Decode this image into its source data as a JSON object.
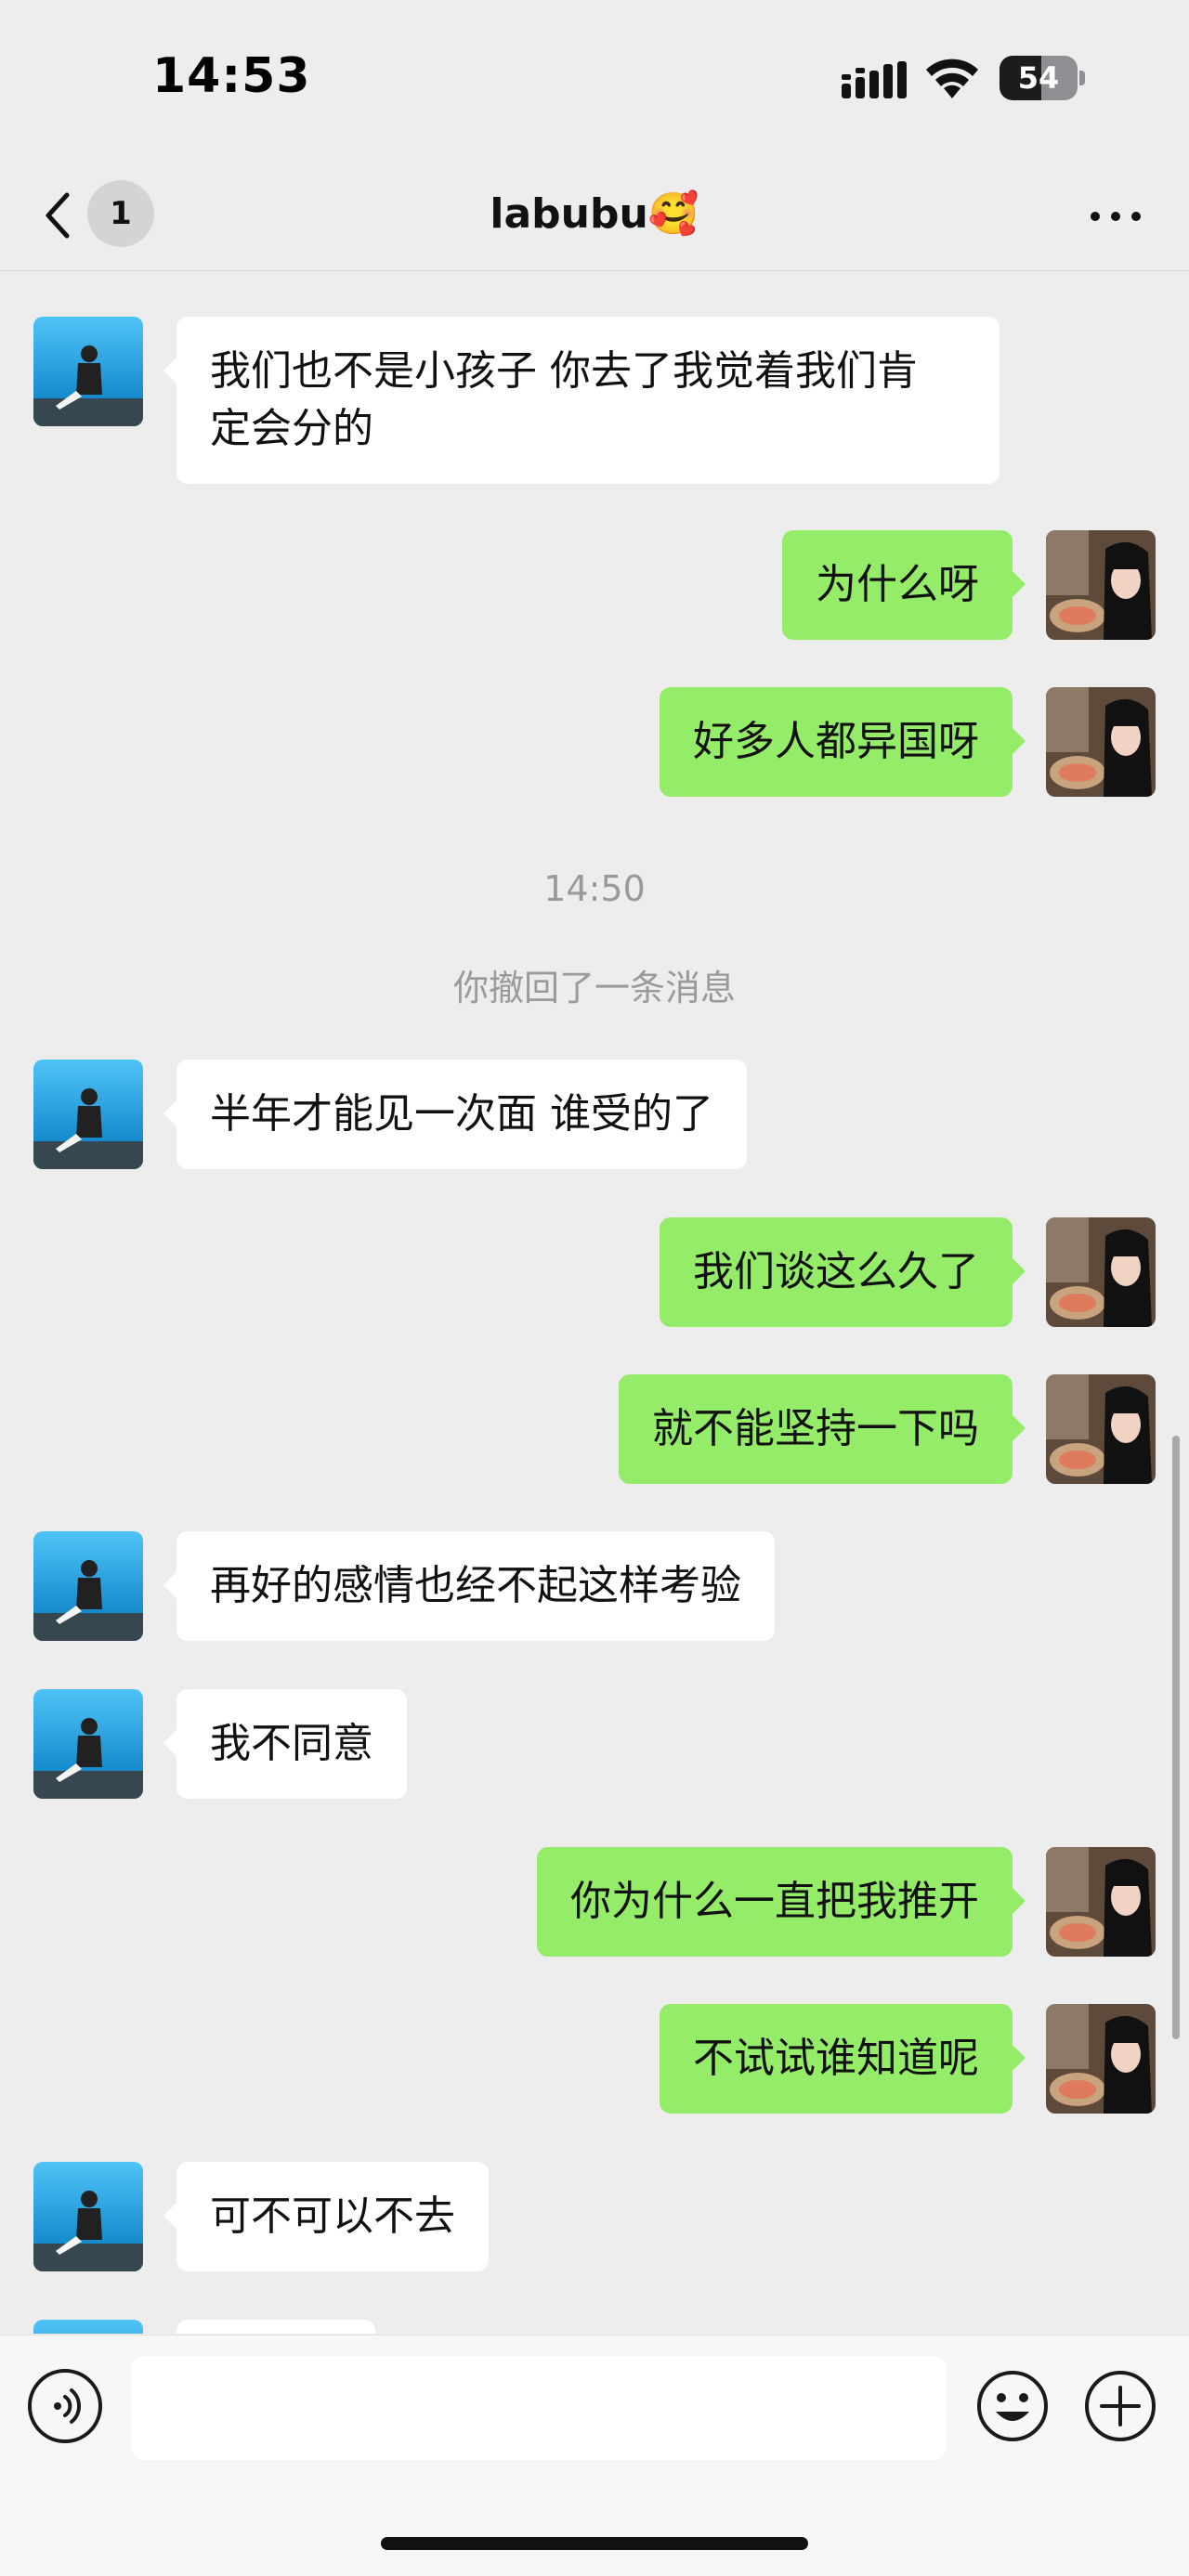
{
  "status_bar": {
    "time": "14:53",
    "battery_level": "54",
    "icons": [
      "signal-icon",
      "wifi-icon",
      "battery-icon"
    ]
  },
  "nav": {
    "back_icon": "chevron-left-icon",
    "unread_count": "1",
    "title": "labubu🥰",
    "more_icon": "more-dots-icon"
  },
  "messages": [
    {
      "side": "left",
      "text_lines": [
        "我们也不是小孩子 你去了我觉着我们肯",
        "定会分的"
      ]
    },
    {
      "side": "right",
      "text": "为什么呀"
    },
    {
      "side": "right",
      "text": "好多人都异国呀"
    },
    {
      "type": "time",
      "text": "14:50"
    },
    {
      "type": "system",
      "text": "你撤回了一条消息"
    },
    {
      "side": "left",
      "text": "半年才能见一次面 谁受的了"
    },
    {
      "side": "right",
      "text": "我们谈这么久了"
    },
    {
      "side": "right",
      "text": "就不能坚持一下吗"
    },
    {
      "side": "left",
      "text": "再好的感情也经不起这样考验"
    },
    {
      "side": "left",
      "text": "我不同意"
    },
    {
      "side": "right",
      "text": "你为什么一直把我推开"
    },
    {
      "side": "right",
      "text": "不试试谁知道呢"
    },
    {
      "side": "left",
      "text": "可不可以不去"
    }
  ],
  "input_bar": {
    "voice_icon": "voice-icon",
    "text_value": "",
    "emoji_icon": "emoji-icon",
    "plus_icon": "plus-icon"
  },
  "colors": {
    "background": "#ededed",
    "sent_bubble": "#95ec69",
    "received_bubble": "#ffffff",
    "system_text": "#9a9a9a"
  }
}
